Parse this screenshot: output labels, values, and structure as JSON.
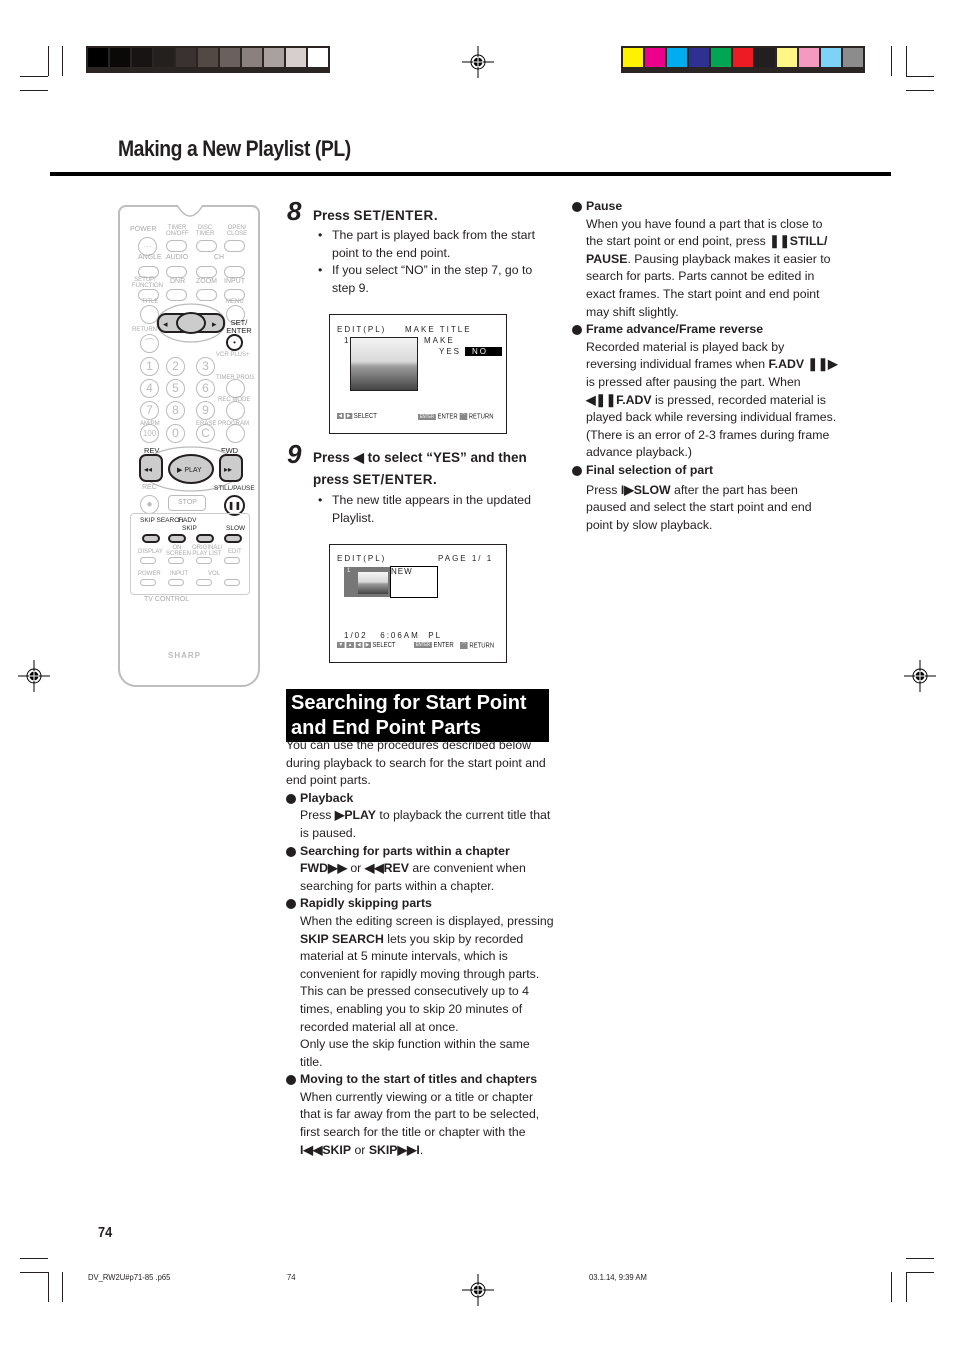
{
  "header": {
    "title": "Making a New Playlist (PL)",
    "grayscale_bar": [
      "#000000",
      "#0b0908",
      "#171413",
      "#24201e",
      "#3a3230",
      "#524945",
      "#6a605d",
      "#8a807d",
      "#a9a19f",
      "#d6cfce",
      "#ffffff"
    ],
    "color_bar": [
      "#fff200",
      "#ec008c",
      "#00aeef",
      "#2e3192",
      "#00a651",
      "#ed1c24",
      "#231f20",
      "#fff685",
      "#f49ac1",
      "#7dd3f7",
      "#8c8c8c"
    ]
  },
  "remote": {
    "brand": "SHARP",
    "labels": {
      "power": "POWER",
      "timer_onoff": "TIMER ON/OFF",
      "disc_timer": "DISC TIMER",
      "open_close": "OPEN/ CLOSE",
      "angle": "ANGLE",
      "audio": "AUDIO",
      "ch": "CH",
      "setup_function": "SETUP/ FUNCTION",
      "dnr": "DNR",
      "zoom": "ZOOM",
      "input": "INPUT",
      "title": "TITLE",
      "menu": "MENU",
      "return": "RETURN",
      "set_enter": "SET/ ENTER",
      "vcr_plus": "VCR PLUS+",
      "timer_prog": "TIMER PROG.",
      "rec_mode": "REC MODE",
      "am_pm": "AM/PM",
      "erase": "ERASE",
      "program": "PROGRAM",
      "rev": "REV",
      "fwd": "FWD",
      "play": "PLAY",
      "rec": "REC",
      "stop": "STOP",
      "still_pause": "STILL/PAUSE",
      "skip_search": "SKIP SEARCH",
      "f_adv": "F.ADV",
      "skip": "SKIP",
      "slow": "SLOW",
      "display": "DISPLAY",
      "on_screen": "ON SCREEN",
      "original_playlist": "ORIGINAL/ PLAY LIST",
      "edit": "EDIT",
      "tv_power": "POWER",
      "tv_input": "INPUT",
      "vol": "VOL",
      "tv_control": "TV CONTROL"
    },
    "digits": [
      "1",
      "2",
      "3",
      "4",
      "5",
      "6",
      "7",
      "8",
      "9",
      "100",
      "0",
      "C"
    ]
  },
  "step8": {
    "number": "8",
    "heading_prefix": "Press ",
    "heading_bold": "SET/ENTER",
    "heading_suffix": ".",
    "bullets": [
      "The part is played back from the start point to the end point.",
      "If you select “NO” in the step 7, go to step 9."
    ],
    "osd": {
      "top_left": "EDIT(PL)",
      "top_right": "MAKE TITLE",
      "index": "1",
      "make": "MAKE",
      "yes": "YES",
      "no": "NO",
      "select": "SELECT",
      "enter_key": "ENTER",
      "enter": "ENTER",
      "return": "RETURN"
    }
  },
  "step9": {
    "number": "9",
    "heading_line1": "Press ◀ to select “YES” and then",
    "heading_line2_prefix": "press ",
    "heading_line2_bold": "SET/ENTER",
    "heading_line2_suffix": ".",
    "bullets": [
      "The new title appears in the updated Playlist."
    ],
    "osd": {
      "top_left": "EDIT(PL)",
      "page": "PAGE 1/ 1",
      "index": "1",
      "new": "NEW",
      "status": "1/02   6:06AM  PL",
      "select": "SELECT",
      "enter_key": "ENTER",
      "enter": "ENTER",
      "return": "RETURN"
    }
  },
  "section": {
    "heading": "Searching for Start Point and End Point Parts",
    "intro": "You can use the procedures described below during playback to search for the start point and end point parts.",
    "items": [
      {
        "title": "Playback",
        "pre": "Press ",
        "bold": "▶PLAY",
        "post": " to playback the current title that is paused."
      },
      {
        "title": "Searching for parts within a chapter",
        "bold1": "FWD▶▶",
        "mid": " or ",
        "bold2": "◀◀REV",
        "post": " are convenient when searching for parts within a chapter."
      },
      {
        "title": "Rapidly skipping parts",
        "pre": "When the editing screen is displayed, pressing ",
        "bold": "SKIP SEARCH",
        "post": " lets you skip by recorded material at 5 minute intervals, which is convenient for rapidly moving through parts. This can be pressed consecutively up to 4 times, enabling you to skip 20 minutes of recorded material all at once.",
        "extra": "Only use the skip function within the same title."
      },
      {
        "title": "Moving to the start of titles and chapters",
        "pre": "When currently viewing or a title or chapter that is far away from the part to be selected, first search for the title or chapter with the ",
        "bold1": "I◀◀SKIP",
        "mid": " or ",
        "bold2": "SKIP▶▶I",
        "post": "."
      }
    ]
  },
  "right_column": {
    "items": [
      {
        "title": "Pause",
        "pre": "When you have found a part that is close to the start point or end point, press ",
        "bold": "❚❚STILL/ PAUSE",
        "post": ". Pausing playback makes it easier to search for parts. Parts cannot be edited in exact frames. The start point and end point may shift slightly."
      },
      {
        "title": "Frame advance/Frame reverse",
        "pre": "Recorded material is played back by reversing individual frames when ",
        "bold1": "F.ADV ❚❚▶",
        "mid": " is pressed after pausing the part. When ",
        "bold2": "◀❚❚F.ADV",
        "post": " is pressed, recorded material is played back while reversing individual frames. (There is an error of 2-3 frames during frame advance playback.)"
      },
      {
        "title": "Final selection of part",
        "pre": "Press ",
        "bold": "I▶SLOW",
        "post": " after the part has been paused and select the start point and end point by slow playback."
      }
    ]
  },
  "footer": {
    "page_number": "74",
    "file": "DV_RW2U#p71-85 .p65",
    "page": "74",
    "timestamp": "03.1.14, 9:39 AM"
  }
}
